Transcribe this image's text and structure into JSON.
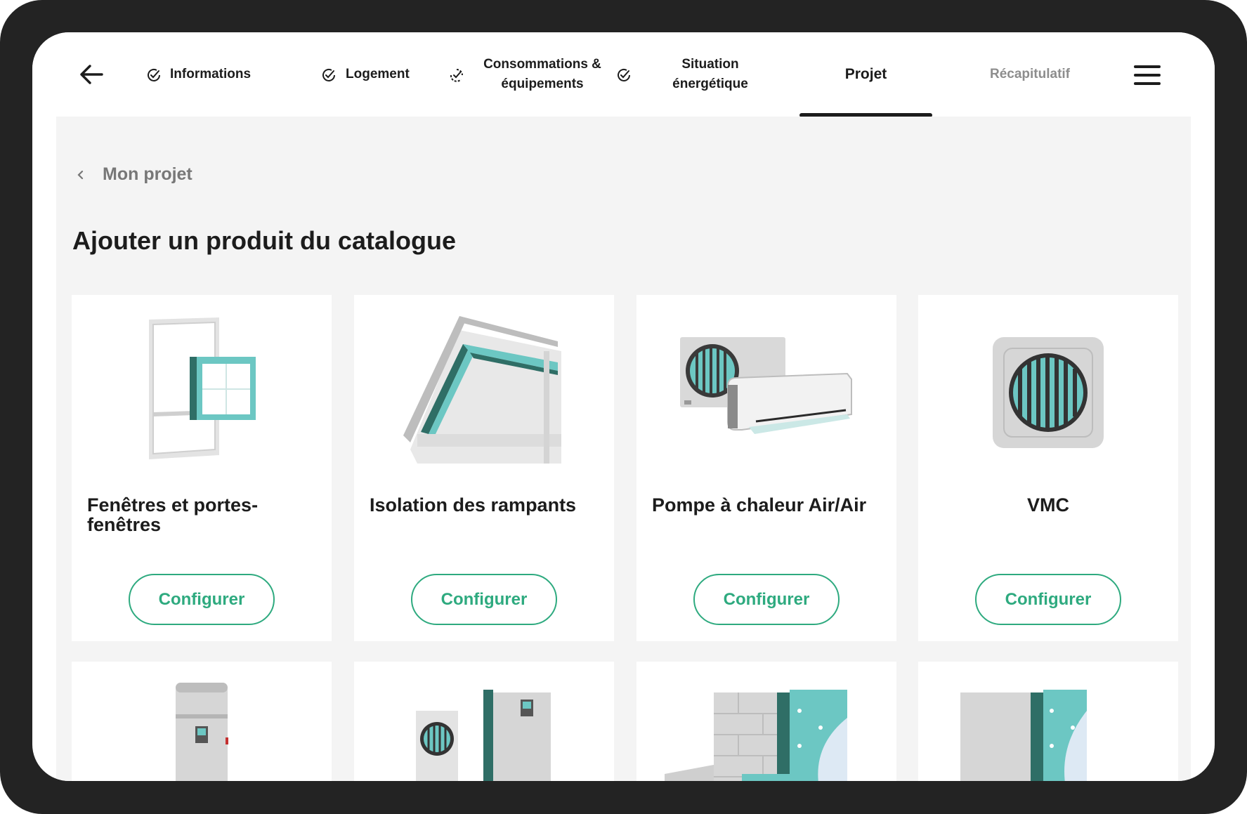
{
  "nav": {
    "steps": [
      {
        "label": "Informations",
        "status": "done"
      },
      {
        "label": "Logement",
        "status": "done"
      },
      {
        "label_line1": "Consommations &",
        "label_line2": "équipements",
        "status": "partial"
      },
      {
        "label_line1": "Situation",
        "label_line2": "énergétique",
        "status": "done"
      },
      {
        "label": "Projet",
        "status": "active"
      },
      {
        "label": "Récapitulatif",
        "status": "upcoming"
      }
    ],
    "icons": {
      "back": "arrow-left-icon",
      "menu": "hamburger-menu-icon",
      "check": "check-circle-icon"
    }
  },
  "breadcrumb": {
    "label": "Mon projet"
  },
  "page": {
    "title": "Ajouter un produit du catalogue"
  },
  "products": [
    {
      "name": "Fenêtres et portes-fenêtres",
      "button": "Configurer",
      "icon": "window-icon"
    },
    {
      "name": "Isolation des rampants",
      "button": "Configurer",
      "icon": "roof-insulation-icon"
    },
    {
      "name": "Pompe à chaleur Air/Air",
      "button": "Configurer",
      "icon": "heat-pump-air-air-icon"
    },
    {
      "name": "VMC",
      "button": "Configurer",
      "icon": "ventilation-fan-icon"
    },
    {
      "name": "",
      "button": "",
      "icon": "water-heater-icon"
    },
    {
      "name": "",
      "button": "",
      "icon": "heat-pump-air-water-icon"
    },
    {
      "name": "",
      "button": "",
      "icon": "exterior-wall-insulation-icon"
    },
    {
      "name": "",
      "button": "",
      "icon": "interior-wall-insulation-icon"
    }
  ],
  "colors": {
    "accent": "#2eaa7f",
    "teal": "#6cc7c3",
    "dark": "#1c1c1c",
    "bezel": "#232323",
    "content_bg": "#f4f4f4"
  }
}
